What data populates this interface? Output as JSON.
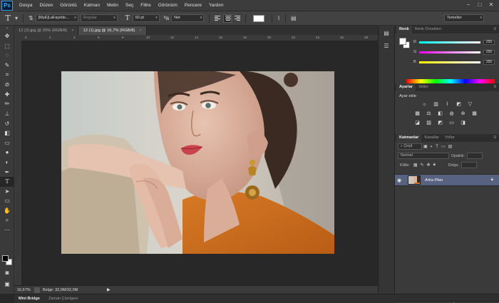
{
  "app": {
    "logo": "Ps"
  },
  "menu": [
    "Dosya",
    "Düzen",
    "Görüntü",
    "Katman",
    "Metin",
    "Seç",
    "Filtre",
    "Görünüm",
    "Pencere",
    "Yardım"
  ],
  "window_controls": [
    "−",
    "□",
    "✕"
  ],
  "options": {
    "tool_glyph": "T",
    "font_family": "[MyE]LaFayette...",
    "font_style": "Regular",
    "font_size": "60 pt",
    "aa_label": "ªa",
    "antialias": "Net",
    "workspace": "Temeller"
  },
  "doc_tabs": [
    {
      "label": "12 (2).jpg @ 25% (RGB/8)",
      "active": false
    },
    {
      "label": "12 (1).jpg @ 16,7% (RGB/8)",
      "active": true
    }
  ],
  "ruler_h": [
    "0",
    "2",
    "4",
    "6",
    "8",
    "10",
    "12",
    "14",
    "16",
    "18",
    "20",
    "22",
    "24",
    "26",
    "28"
  ],
  "status": {
    "zoom": "16,67%",
    "doc_size": "Belge: 32,0M/32,0M"
  },
  "bottom_tabs": [
    "Mini Bridge",
    "Zaman Çizelgesi"
  ],
  "color_panel": {
    "tabs": [
      "Renk",
      "Renk Örnekleri"
    ],
    "channels": [
      {
        "label": "R",
        "value": "255",
        "gradient": "linear-gradient(to right,#00ffff,#ffffff)"
      },
      {
        "label": "G",
        "value": "255",
        "gradient": "linear-gradient(to right,#ff00ff,#ffffff)"
      },
      {
        "label": "B",
        "value": "255",
        "gradient": "linear-gradient(to right,#ffff00,#ffffff)"
      }
    ]
  },
  "adjust_panel": {
    "tabs": [
      "Ayarlar",
      "Stiller"
    ],
    "title": "Ayar ekle"
  },
  "layers_panel": {
    "tabs": [
      "Katmanlar",
      "Kanallar",
      "Yollar"
    ],
    "filter_label": "Çeşit",
    "blend_mode": "Normal",
    "opacity_label": "Opaklık:",
    "lock_label": "Kilitle:",
    "fill_label": "Dolgu:",
    "layers": [
      {
        "name": "Arka Plan",
        "visible": true,
        "locked": true
      }
    ]
  },
  "colors": {
    "layer_selected": "#566280",
    "accent": "#31a8ff"
  }
}
